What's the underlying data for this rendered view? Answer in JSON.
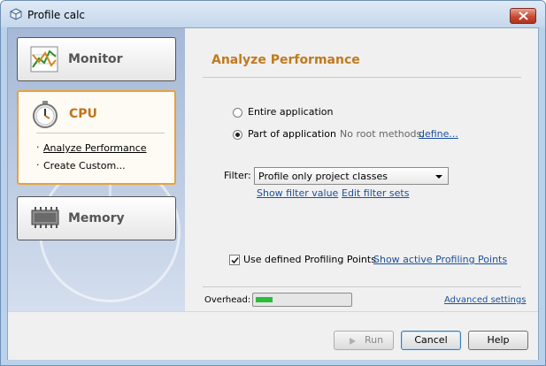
{
  "window": {
    "title": "Profile calc"
  },
  "categories": {
    "monitor": {
      "label": "Monitor"
    },
    "cpu": {
      "label": "CPU",
      "items": [
        {
          "label": "Analyze Performance",
          "selected": true
        },
        {
          "label": "Create Custom..."
        }
      ]
    },
    "memory": {
      "label": "Memory"
    }
  },
  "analyze": {
    "title": "Analyze Performance",
    "options": [
      {
        "label": "Entire application",
        "checked": false
      },
      {
        "label": "Part of application",
        "checked": true
      }
    ],
    "no_root_text": "No root methods,",
    "define_link": "define...",
    "filter": {
      "label": "Filter:",
      "selected": "Profile only project classes",
      "show_value_link": "Show filter value",
      "edit_sets_link": "Edit filter sets"
    },
    "profiling_points": {
      "checkbox_label": "Use defined Profiling Points",
      "checked": true,
      "show_link": "Show active Profiling Points"
    },
    "overhead": {
      "label": "Overhead:",
      "level_fraction": 0.18
    },
    "advanced_link": "Advanced settings"
  },
  "buttons": {
    "run": "Run",
    "cancel": "Cancel",
    "help": "Help"
  },
  "colors": {
    "accent_orange": "#c07a1d",
    "link_blue": "#1a4f9c",
    "overhead_green": "#2bbd3a"
  }
}
